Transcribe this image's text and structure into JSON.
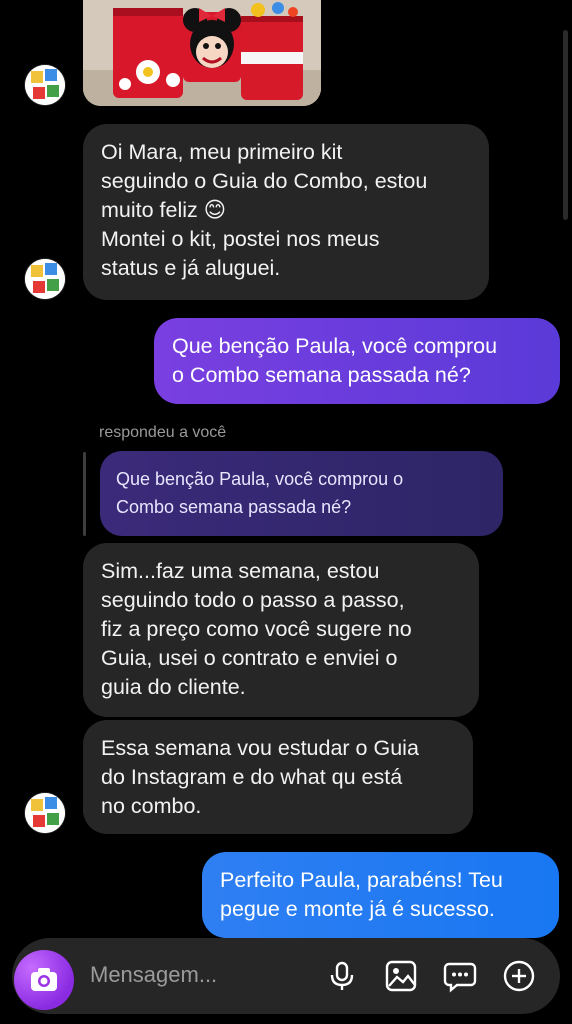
{
  "messages": {
    "m1": "Oi Mara, meu primeiro kit\nseguindo o Guia do Combo, estou\nmuito feliz 😊\nMontei o kit, postei nos meus\nstatus e já aluguei.",
    "m2": "Que benção Paula, você comprou\no Combo semana passada né?",
    "reply_label": "respondeu a você",
    "quoted": "Que benção Paula, você comprou o\nCombo semana passada né?",
    "m3": "Sim...faz uma semana, estou\nseguindo todo o passo a passo,\nfiz a preço como você sugere no\nGuia, usei o contrato e enviei o\nguia do cliente.",
    "m4": "Essa semana vou estudar o Guia\ndo Instagram e do what qu está\nno combo.",
    "m5": "Perfeito Paula, parabéns! Teu\npegue e monte já é sucesso."
  },
  "composer": {
    "placeholder": "Mensagem..."
  },
  "icons": [
    "camera-icon",
    "microphone-icon",
    "image-icon",
    "sticker-chat-icon",
    "plus-icon"
  ],
  "colors": {
    "incoming": "#262626",
    "outgoing_purple": "#6f3de0",
    "outgoing_blue": "#1f7af2",
    "background": "#000000"
  }
}
